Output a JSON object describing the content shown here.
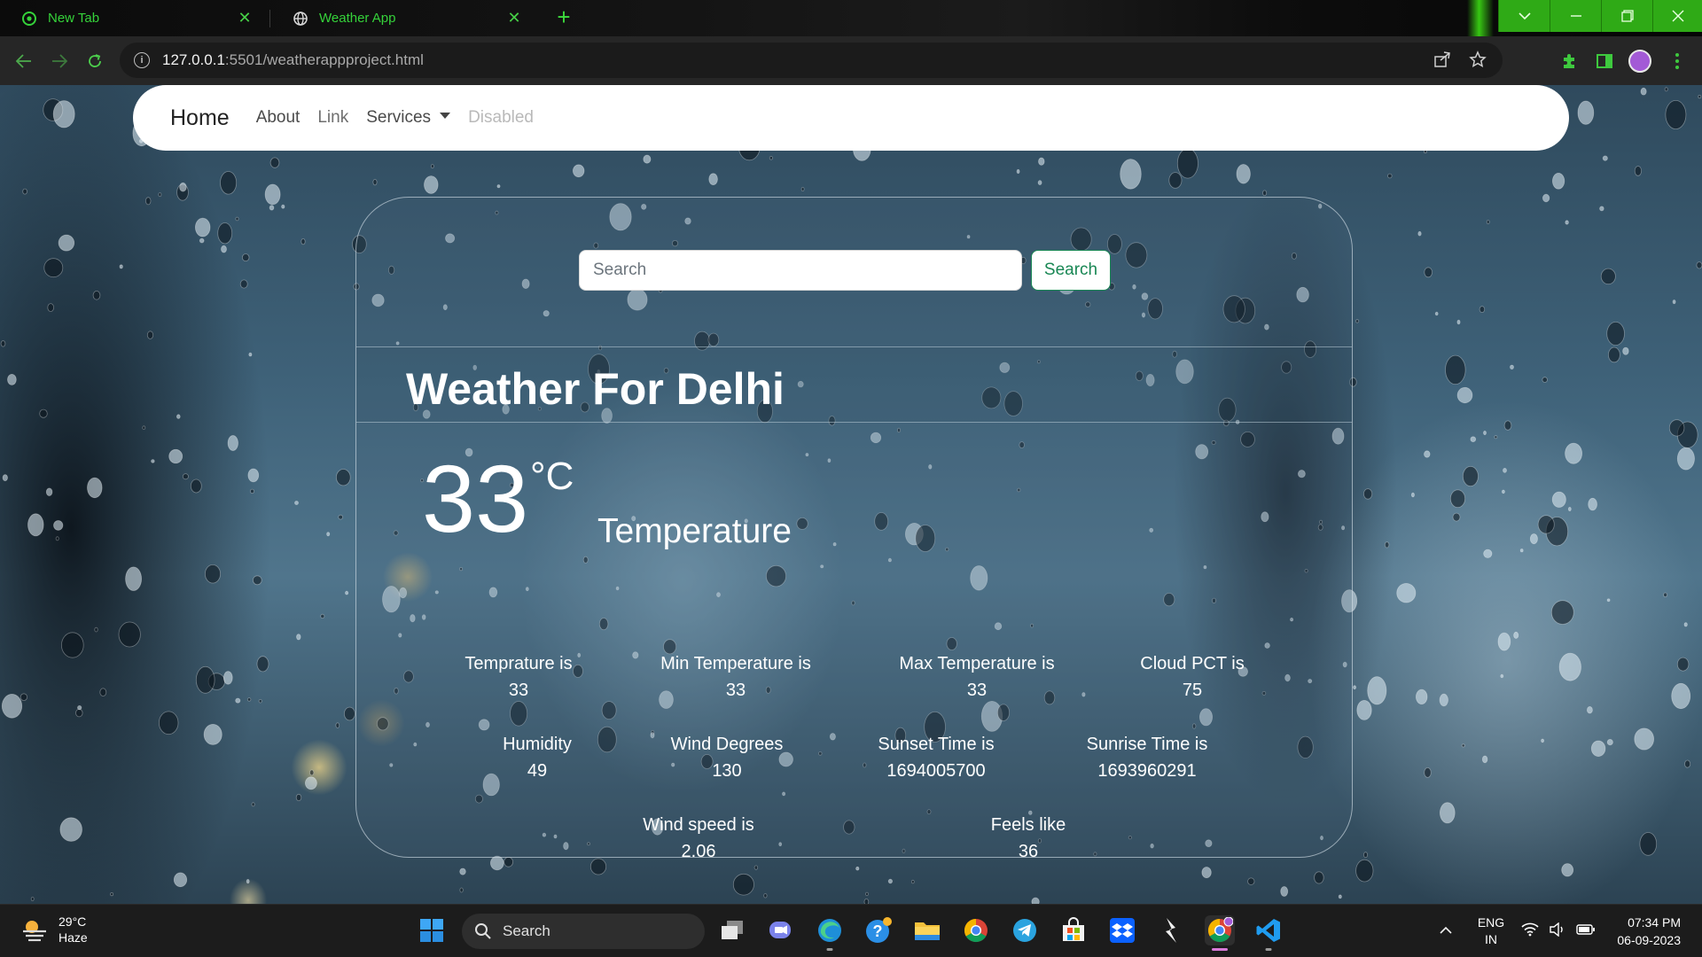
{
  "browser": {
    "tabs": [
      {
        "title": "New Tab"
      },
      {
        "title": "Weather App"
      }
    ],
    "url_host": "127.0.0.1",
    "url_rest": ":5501/weatherappproject.html"
  },
  "navbar": {
    "brand": "Home",
    "links": [
      {
        "label": "About"
      },
      {
        "label": "Link"
      },
      {
        "label": "Services"
      },
      {
        "label": "Disabled"
      }
    ]
  },
  "search": {
    "placeholder": "Search",
    "button_label": "Search"
  },
  "weather": {
    "title": "Weather For Delhi",
    "temp_value": "33",
    "temp_unit": "°C",
    "temp_label": "Temperature",
    "stats": [
      {
        "label": "Temprature is",
        "value": "33"
      },
      {
        "label": "Min Temperature is",
        "value": "33"
      },
      {
        "label": "Max Temperature is",
        "value": "33"
      },
      {
        "label": "Cloud PCT is",
        "value": "75"
      },
      {
        "label": "Humidity",
        "value": "49"
      },
      {
        "label": "Wind Degrees",
        "value": "130"
      },
      {
        "label": "Sunset Time is",
        "value": "1694005700"
      },
      {
        "label": "Sunrise Time is",
        "value": "1693960291"
      },
      {
        "label": "Wind speed is",
        "value": "2.06"
      },
      {
        "label": "Feels like",
        "value": "36"
      }
    ]
  },
  "taskbar": {
    "weather_temp": "29°C",
    "weather_desc": "Haze",
    "search_label": "Search",
    "lang_1": "ENG",
    "lang_2": "IN",
    "time": "07:34 PM",
    "date": "06-09-2023"
  },
  "colors": {
    "accent_green": "#198754",
    "chrome_green": "#35d23a",
    "navbar_bg": "#ffffff",
    "taskbar_bg": "#1c1c1c"
  }
}
